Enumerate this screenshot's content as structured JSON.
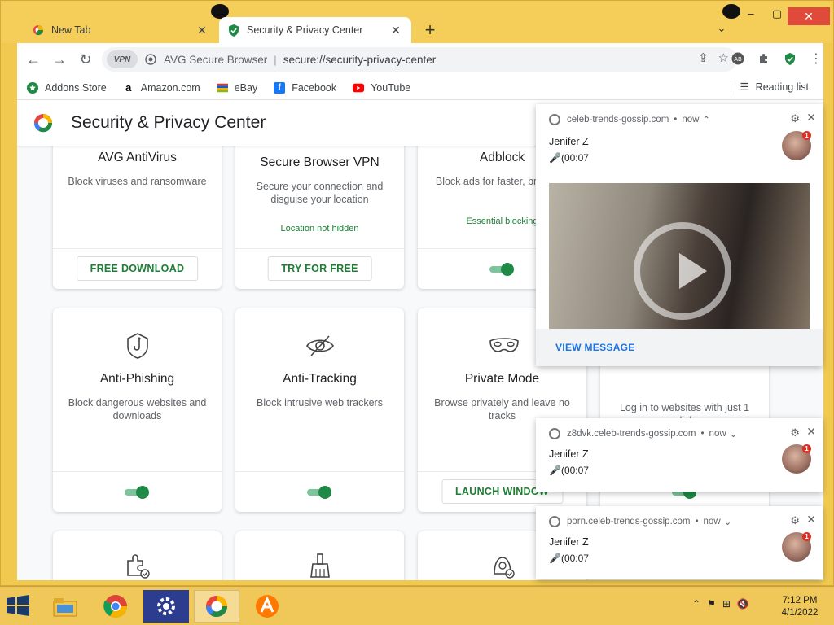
{
  "browser": {
    "tabs": [
      {
        "label": "New Tab"
      },
      {
        "label": "Security & Privacy Center"
      }
    ],
    "vpn_chip": "VPN",
    "omnibox_brand": "AVG Secure Browser",
    "omnibox_separator": "|",
    "url": "secure://security-privacy-center"
  },
  "bookmarks": [
    {
      "label": "Addons Store",
      "icon": "addons-store-icon",
      "color": "#1e8a45"
    },
    {
      "label": "Amazon.com",
      "icon": "amazon-icon",
      "color": "#000000"
    },
    {
      "label": "eBay",
      "icon": "ebay-icon",
      "color": "#e53238"
    },
    {
      "label": "Facebook",
      "icon": "facebook-icon",
      "color": "#1877f2"
    },
    {
      "label": "YouTube",
      "icon": "youtube-icon",
      "color": "#ff0000"
    }
  ],
  "reading_list": "Reading list",
  "page": {
    "title": "Security & Privacy Center",
    "cards": [
      {
        "title": "AVG AntiVirus",
        "desc": "Block viruses and ransomware",
        "button": "FREE DOWNLOAD"
      },
      {
        "title": "Secure Browser VPN",
        "desc": "Secure your connection and disguise your location",
        "status": "Location not hidden",
        "button": "TRY FOR FREE"
      },
      {
        "title": "Adblock",
        "desc": "Block ads for faster, browsing",
        "status": "Essential blocking",
        "toggle_on": true
      },
      {
        "title": "Anti-Phishing",
        "desc": "Block dangerous websites and downloads",
        "toggle_on": true,
        "icon": "hook-shield-icon"
      },
      {
        "title": "Anti-Tracking",
        "desc": "Block intrusive web trackers",
        "toggle_on": true,
        "icon": "eye-slash-icon"
      },
      {
        "title": "Private Mode",
        "desc": "Browse privately and leave no tracks",
        "button": "LAUNCH WINDOW",
        "icon": "mask-icon"
      },
      {
        "desc": "Log in to websites with just 1 click",
        "toggle_on": true
      }
    ]
  },
  "notifications": [
    {
      "site": "celeb-trends-gossip.com",
      "time": "now",
      "chevron": "^",
      "name": "Jenifer Z",
      "message": "🎤(00:07",
      "badge": "1",
      "action": "VIEW MESSAGE"
    },
    {
      "site": "z8dvk.celeb-trends-gossip.com",
      "time": "now",
      "chevron": "v",
      "name": "Jenifer Z",
      "message": "🎤(00:07",
      "badge": "1"
    },
    {
      "site": "porn.celeb-trends-gossip.com",
      "time": "now",
      "chevron": "v",
      "name": "Jenifer Z",
      "message": "🎤(00:07",
      "badge": "1"
    }
  ],
  "taskbar": {
    "apps": [
      "file-explorer-icon",
      "chrome-icon",
      "settings-icon",
      "avg-browser-icon",
      "avast-icon"
    ],
    "time": "7:12 PM",
    "date": "4/1/2022"
  },
  "colors": {
    "frame": "#f4ce59",
    "accent_green": "#1e8a45",
    "link_blue": "#1a73e8"
  }
}
